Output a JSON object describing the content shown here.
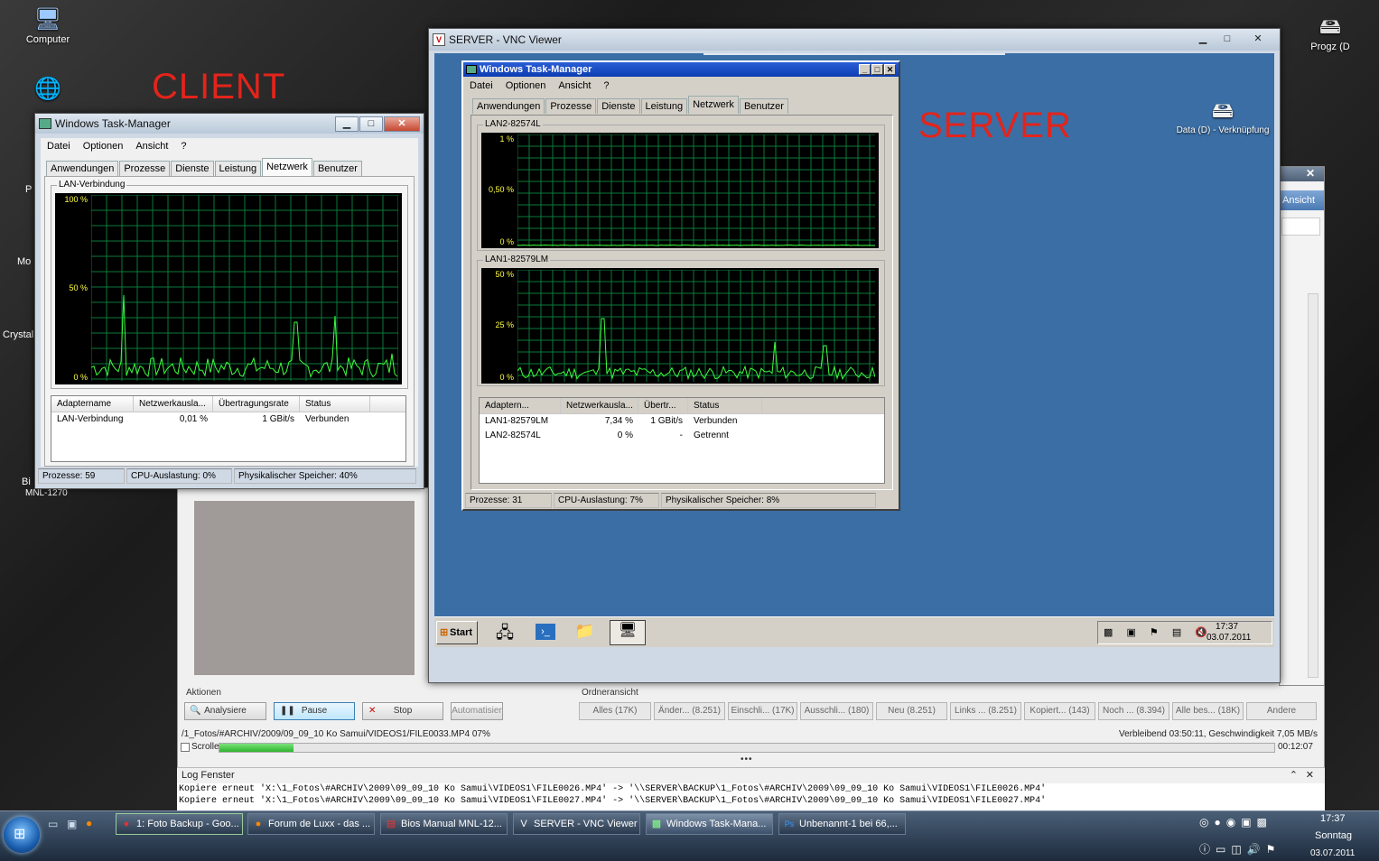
{
  "desktop": {
    "labels": {
      "client": "CLIENT",
      "server": "SERVER"
    },
    "icons": [
      {
        "label": "Computer",
        "icon": "computer-icon"
      },
      {
        "label": "Progz (D",
        "icon": "drive-shortcut-icon"
      }
    ],
    "partial_left": [
      "P",
      "Mo",
      "Crystal",
      "Bi",
      "MNL-1270"
    ]
  },
  "client_tm": {
    "title": "Windows Task-Manager",
    "menu": [
      "Datei",
      "Optionen",
      "Ansicht",
      "?"
    ],
    "tabs": [
      "Anwendungen",
      "Prozesse",
      "Dienste",
      "Leistung",
      "Netzwerk",
      "Benutzer"
    ],
    "active_tab": "Netzwerk",
    "graph": {
      "label": "LAN-Verbindung",
      "y_top": "100 %",
      "y_mid": "50 %",
      "y_bot": "0 %"
    },
    "columns": [
      "Adaptername",
      "Netzwerkausla...",
      "Übertragungsrate",
      "Status"
    ],
    "rows": [
      {
        "name": "LAN-Verbindung",
        "util": "0,01 %",
        "rate": "1 GBit/s",
        "status": "Verbunden"
      }
    ],
    "status": {
      "proc": "Prozesse: 59",
      "cpu": "CPU-Auslastung: 0%",
      "mem": "Physikalischer Speicher: 40%"
    }
  },
  "vnc": {
    "title": "SERVER - VNC Viewer",
    "server_icon": "Data (D) - Verknüpfung",
    "tm": {
      "title": "Windows Task-Manager",
      "menu": [
        "Datei",
        "Optionen",
        "Ansicht",
        "?"
      ],
      "tabs": [
        "Anwendungen",
        "Prozesse",
        "Dienste",
        "Leistung",
        "Netzwerk",
        "Benutzer"
      ],
      "active_tab": "Netzwerk",
      "graph1": {
        "label": "LAN2-82574L",
        "y_top": "1 %",
        "y_mid": "0,50 %",
        "y_bot": "0 %"
      },
      "graph2": {
        "label": "LAN1-82579LM",
        "y_top": "50 %",
        "y_mid": "25 %",
        "y_bot": "0 %"
      },
      "columns": [
        "Adaptern...",
        "Netzwerkausla...",
        "Übertr...",
        "Status"
      ],
      "rows": [
        {
          "name": "LAN1-82579LM",
          "util": "7,34 %",
          "rate": "1 GBit/s",
          "status": "Verbunden"
        },
        {
          "name": "LAN2-82574L",
          "util": "0 %",
          "rate": "-",
          "status": "Getrennt"
        }
      ],
      "status": {
        "proc": "Prozesse: 31",
        "cpu": "CPU-Auslastung: 7%",
        "mem": "Physikalischer Speicher: 8%"
      }
    },
    "start": "Start",
    "clock": {
      "time": "17:37",
      "date": "03.07.2011"
    }
  },
  "backup": {
    "right_label": "Ansicht",
    "actions_label": "Aktionen",
    "buttons": {
      "analyze": "Analysiere",
      "pause": "Pause",
      "stop": "Stop",
      "auto": "Automatisier"
    },
    "view_label": "Ordneransicht",
    "filters": [
      "Alles (17K)",
      "Änder... (8.251)",
      "Einschli... (17K)",
      "Ausschli... (180)",
      "Neu (8.251)",
      "Links ... (8.251)",
      "Kopiert... (143)",
      "Noch ... (8.394)",
      "Alle bes... (18K)",
      "Andere"
    ],
    "path": "/1_Fotos/#ARCHIV/2009/09_09_10 Ko Samui/VIDEOS1/FILE0033.MP4 07%",
    "remaining": "Verbleibend 03:50:11, Geschwindigkeit 7,05 MB/s",
    "scroll_label": "Scrolle",
    "elapsed": "00:12:07",
    "progress": 0.07,
    "log_title": "Log Fenster",
    "log": [
      "Kopiere erneut 'X:\\1_Fotos\\#ARCHIV\\2009\\09_09_10 Ko Samui\\VIDEOS1\\FILE0026.MP4' -> '\\\\SERVER\\BACKUP\\1_Fotos\\#ARCHIV\\2009\\09_09_10 Ko Samui\\VIDEOS1\\FILE0026.MP4'",
      "Kopiere erneut 'X:\\1_Fotos\\#ARCHIV\\2009\\09_09_10 Ko Samui\\VIDEOS1\\FILE0027.MP4' -> '\\\\SERVER\\BACKUP\\1_Fotos\\#ARCHIV\\2009\\09_09_10 Ko Samui\\VIDEOS1\\FILE0027.MP4'"
    ]
  },
  "taskbar": {
    "items": [
      "1: Foto Backup - Goo...",
      "Forum de Luxx - das ...",
      "Bios Manual MNL-12...",
      "SERVER - VNC Viewer",
      "Windows Task-Mana...",
      "Unbenannt-1 bei 66,..."
    ],
    "time": "17:37",
    "day": "Sonntag",
    "date": "03.07.2011"
  }
}
